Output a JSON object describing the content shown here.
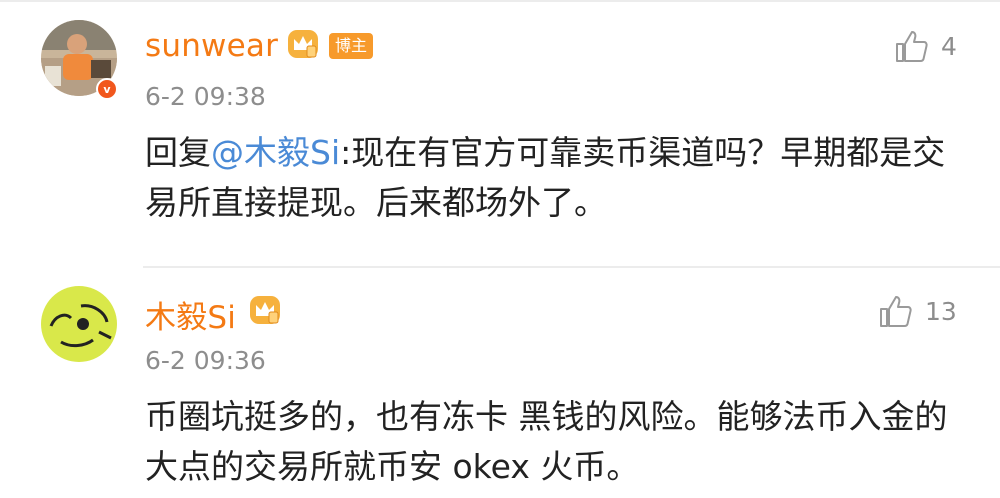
{
  "comments": [
    {
      "username": "sunwear",
      "badge": "博主",
      "time": "6-2 09:38",
      "likes": "4",
      "reply_prefix": "回复",
      "mention": "@木毅Si",
      "text": ":现在有官方可靠卖币渠道吗？早期都是交易所直接提现。后来都场外了。",
      "verified_badge": "v",
      "accent_color": "#f47a14"
    },
    {
      "username": "木毅Si",
      "time": "6-2 09:36",
      "likes": "13",
      "text": "币圈坑挺多的，也有冻卡 黑钱的风险。能够法币入金的 大点的交易所就币安 okex 火币。",
      "accent_color": "#f47a14"
    }
  ],
  "icons": [
    "crown-icon",
    "thumbs-up-icon",
    "verified-icon"
  ],
  "colors": {
    "username": "#f47a14",
    "link": "#4a8ad6",
    "badge_bg": "#f79a2b",
    "meta": "#8d8d8d"
  }
}
